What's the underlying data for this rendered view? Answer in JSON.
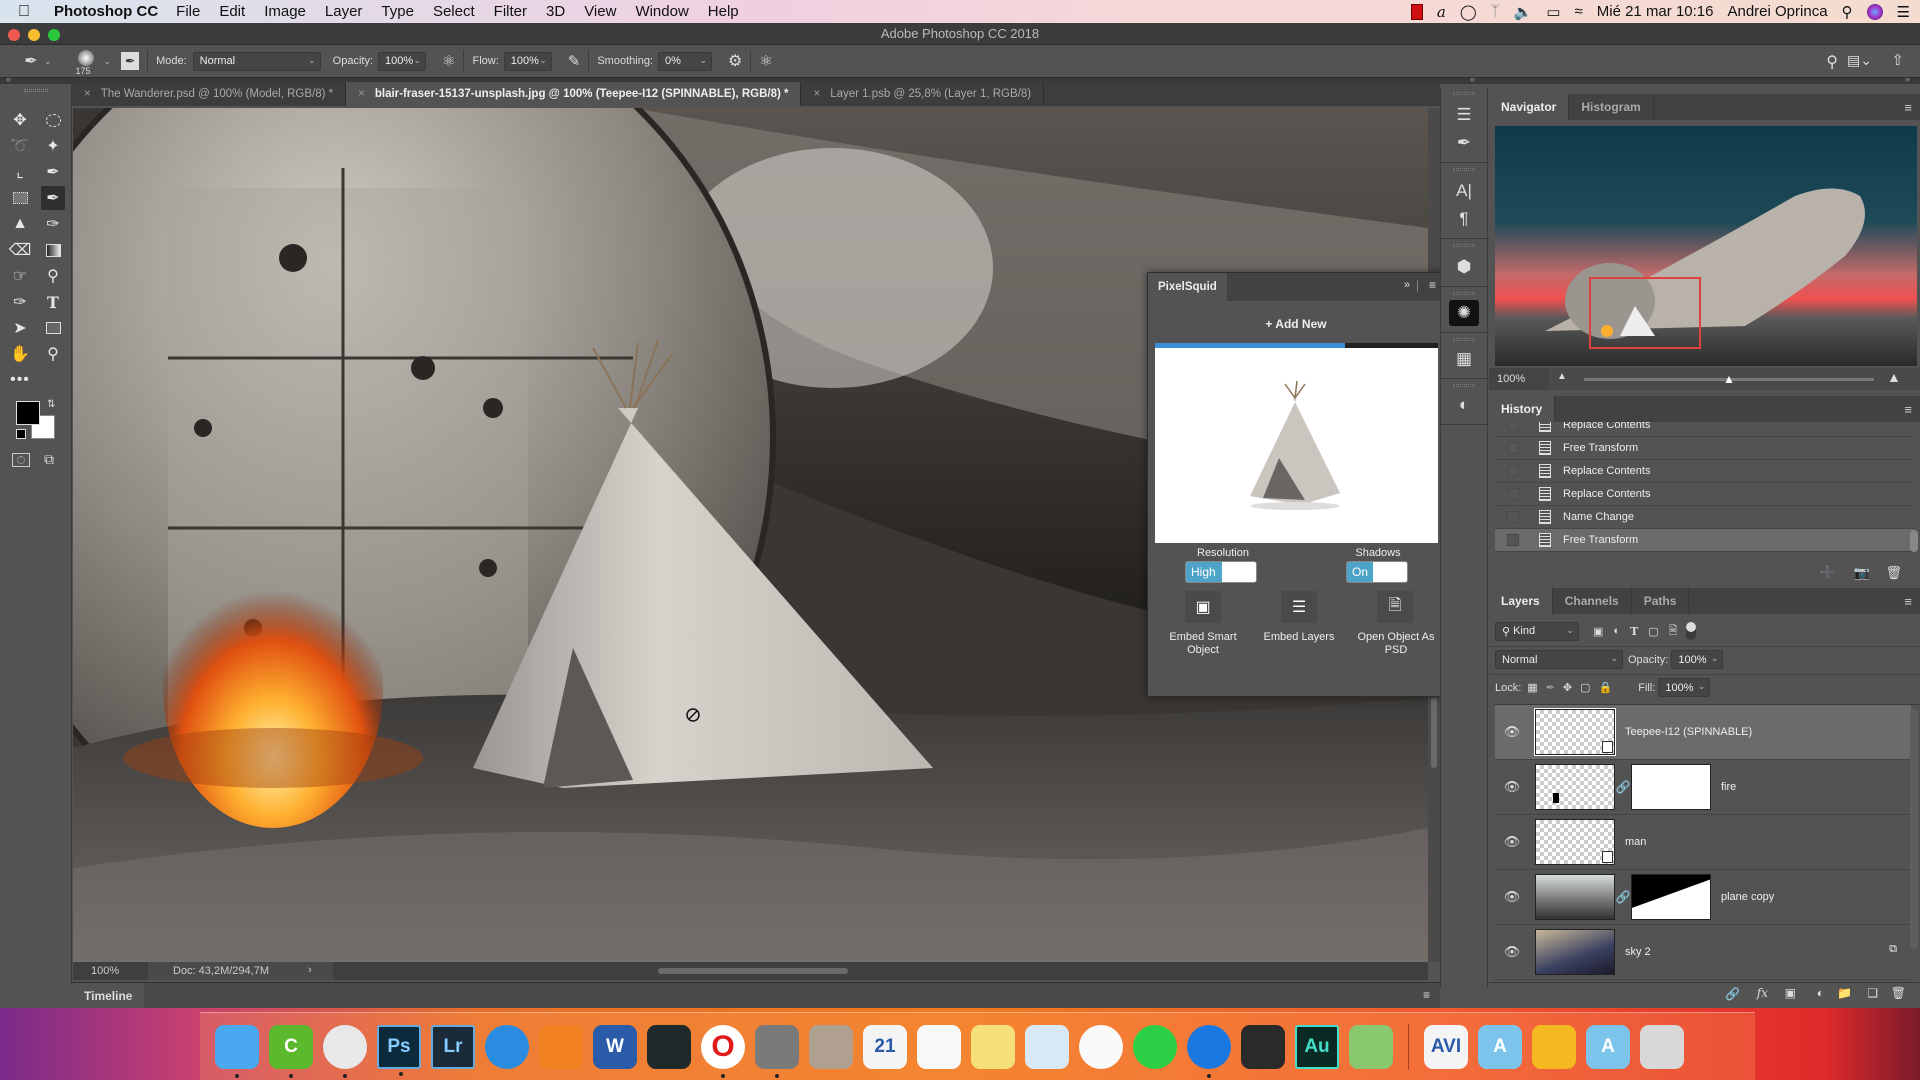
{
  "menubar": {
    "app_name": "Photoshop CC",
    "items": [
      "File",
      "Edit",
      "Image",
      "Layer",
      "Type",
      "Select",
      "Filter",
      "3D",
      "View",
      "Window",
      "Help"
    ],
    "datetime": "Mié 21 mar  10:16",
    "user": "Andrei Oprinca"
  },
  "window": {
    "title": "Adobe Photoshop CC 2018"
  },
  "options": {
    "brush_size": "175",
    "mode_label": "Mode:",
    "mode_value": "Normal",
    "opacity_label": "Opacity:",
    "opacity_value": "100%",
    "flow_label": "Flow:",
    "flow_value": "100%",
    "smoothing_label": "Smoothing:",
    "smoothing_value": "0%"
  },
  "doc_tabs": [
    {
      "label": "The Wanderer.psd @ 100% (Model, RGB/8) *",
      "active": false
    },
    {
      "label": "blair-fraser-15137-unsplash.jpg @ 100% (Teepee-I12 (SPINNABLE), RGB/8) *",
      "active": true
    },
    {
      "label": "Layer 1.psb @ 25,8% (Layer 1, RGB/8)",
      "active": false
    }
  ],
  "status": {
    "zoom": "100%",
    "doc_size": "Doc: 43,2M/294,7M"
  },
  "timeline": {
    "label": "Timeline"
  },
  "navigator": {
    "tabs": [
      "Navigator",
      "Histogram"
    ],
    "zoom": "100%",
    "zoom_slider_fraction": 0.5
  },
  "history": {
    "title": "History",
    "items": [
      "Replace Contents",
      "Free Transform",
      "Replace Contents",
      "Replace Contents",
      "Name Change",
      "Free Transform"
    ],
    "selected_index": 5
  },
  "layers": {
    "tabs": [
      "Layers",
      "Channels",
      "Paths"
    ],
    "filter_kind": "Kind",
    "blend_mode": "Normal",
    "opacity_label": "Opacity:",
    "opacity_value": "100%",
    "lock_label": "Lock:",
    "fill_label": "Fill:",
    "fill_value": "100%",
    "items": [
      {
        "name": "Teepee-I12 (SPINNABLE)",
        "visible": true,
        "selected": true
      },
      {
        "name": "fire",
        "visible": true,
        "selected": false
      },
      {
        "name": "man",
        "visible": true,
        "selected": false
      },
      {
        "name": "plane copy",
        "visible": true,
        "selected": false
      },
      {
        "name": "sky 2",
        "visible": true,
        "selected": false
      }
    ]
  },
  "pixelsquid": {
    "title": "PixelSquid",
    "add_new": "+ Add New",
    "progress_fraction": 0.67,
    "resolution_label": "Resolution",
    "resolution_value": "High",
    "shadows_label": "Shadows",
    "shadows_value": "On",
    "embed_smart_object": "Embed Smart Object",
    "embed_layers": "Embed Layers",
    "open_as_psd": "Open Object As PSD"
  },
  "dock": {
    "apps": [
      {
        "name": "Finder",
        "label": "",
        "color": "#4aa8f0",
        "running": true
      },
      {
        "name": "Camtasia",
        "label": "C",
        "color": "#5cb82c",
        "running": true
      },
      {
        "name": "Chrome",
        "label": "",
        "color": "#e8e8e8",
        "running": true
      },
      {
        "name": "Photoshop",
        "label": "Ps",
        "color": "#0b2a3c",
        "running": true
      },
      {
        "name": "Lightroom",
        "label": "Lr",
        "color": "#1a2a38",
        "running": false
      },
      {
        "name": "Safari",
        "label": "",
        "color": "#2a8ce0",
        "running": false
      },
      {
        "name": "VLC",
        "label": "",
        "color": "#f08020",
        "running": false
      },
      {
        "name": "Word",
        "label": "W",
        "color": "#2b5caa",
        "running": false
      },
      {
        "name": "Activity Monitor",
        "label": "",
        "color": "#1e2a2a",
        "running": false
      },
      {
        "name": "Opera",
        "label": "O",
        "color": "#e01a1a",
        "running": true
      },
      {
        "name": "System Preferences",
        "label": "",
        "color": "#7a7a7a",
        "running": true
      },
      {
        "name": "Calculator",
        "label": "",
        "color": "#b0a090",
        "running": false
      },
      {
        "name": "Calendar",
        "label": "21",
        "color": "#f4f4f4",
        "running": false
      },
      {
        "name": "Reminders",
        "label": "",
        "color": "#f8f8f8",
        "running": false
      },
      {
        "name": "Notes",
        "label": "",
        "color": "#f6e07a",
        "running": false
      },
      {
        "name": "Preview",
        "label": "",
        "color": "#d8e8f8",
        "running": false
      },
      {
        "name": "Photos",
        "label": "",
        "color": "#fafafa",
        "running": false
      },
      {
        "name": "WhatsApp",
        "label": "",
        "color": "#2cd046",
        "running": false
      },
      {
        "name": "Spark",
        "label": "",
        "color": "#1a78e0",
        "running": true
      },
      {
        "name": "Final Cut Pro",
        "label": "",
        "color": "#2a2a2a",
        "running": false
      },
      {
        "name": "Audition",
        "label": "Au",
        "color": "#0a2a24",
        "running": false
      },
      {
        "name": "MacFamilyTree",
        "label": "",
        "color": "#8ac870",
        "running": false
      }
    ],
    "others": [
      {
        "name": "AVI file",
        "label": "AVI",
        "color": "#f4f4f4"
      },
      {
        "name": "Applications folder",
        "label": "A",
        "color": "#7cc4ec"
      },
      {
        "name": "Drive",
        "label": "",
        "color": "#f4b820"
      },
      {
        "name": "Downloads folder",
        "label": "A",
        "color": "#7cc4ec"
      },
      {
        "name": "Trash",
        "label": "",
        "color": "#d8d8d8"
      }
    ]
  }
}
